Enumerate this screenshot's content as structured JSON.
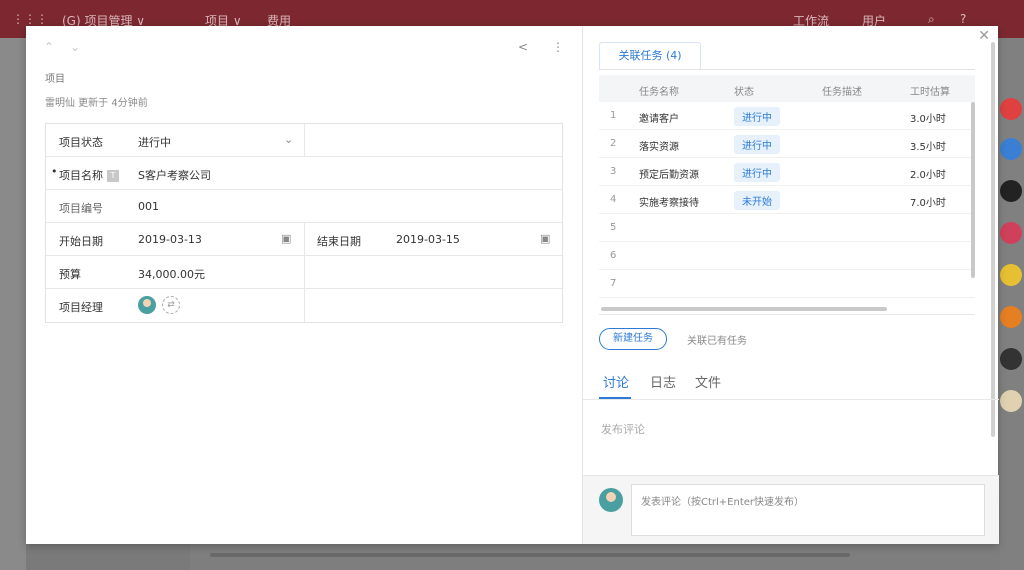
{
  "app": {
    "title": "(G) 项目管理 ∨",
    "nav": [
      "项目 ∨",
      "费用"
    ],
    "right_nav": [
      "工作流",
      "用户"
    ]
  },
  "header": {
    "breadcrumb": "项目",
    "meta": "雷明仙 更新于 4分钟前"
  },
  "form": {
    "status_label": "项目状态",
    "status_value": "进行中",
    "name_label": "项目名称",
    "name_value": "S客户考察公司",
    "number_label": "项目编号",
    "number_value": "001",
    "start_label": "开始日期",
    "start_value": "2019-03-13",
    "end_label": "结束日期",
    "end_value": "2019-03-15",
    "budget_label": "预算",
    "budget_value": "34,000.00元",
    "manager_label": "项目经理"
  },
  "tasks": {
    "tab_label": "关联任务 (4)",
    "columns": [
      "任务名称",
      "状态",
      "任务描述",
      "工时估算"
    ],
    "rows": [
      {
        "num": "1",
        "name": "邀请客户",
        "status": "进行中",
        "hours": "3.0小时"
      },
      {
        "num": "2",
        "name": "落实资源",
        "status": "进行中",
        "hours": "3.5小时"
      },
      {
        "num": "3",
        "name": "预定后勤资源",
        "status": "进行中",
        "hours": "2.0小时"
      },
      {
        "num": "4",
        "name": "实施考察接待",
        "status": "未开始",
        "hours": "7.0小时"
      },
      {
        "num": "5",
        "name": "",
        "status": "",
        "hours": ""
      },
      {
        "num": "6",
        "name": "",
        "status": "",
        "hours": ""
      },
      {
        "num": "7",
        "name": "",
        "status": "",
        "hours": ""
      }
    ],
    "new_button": "新建任务",
    "link_existing": "关联已有任务"
  },
  "discussion": {
    "tabs": [
      "讨论",
      "日志",
      "文件"
    ],
    "empty_text": "发布评论",
    "input_placeholder": "发表评论（按Ctrl+Enter快速发布）"
  },
  "colors": {
    "accent": "#2d7bd6",
    "topbar": "#7d2830"
  }
}
